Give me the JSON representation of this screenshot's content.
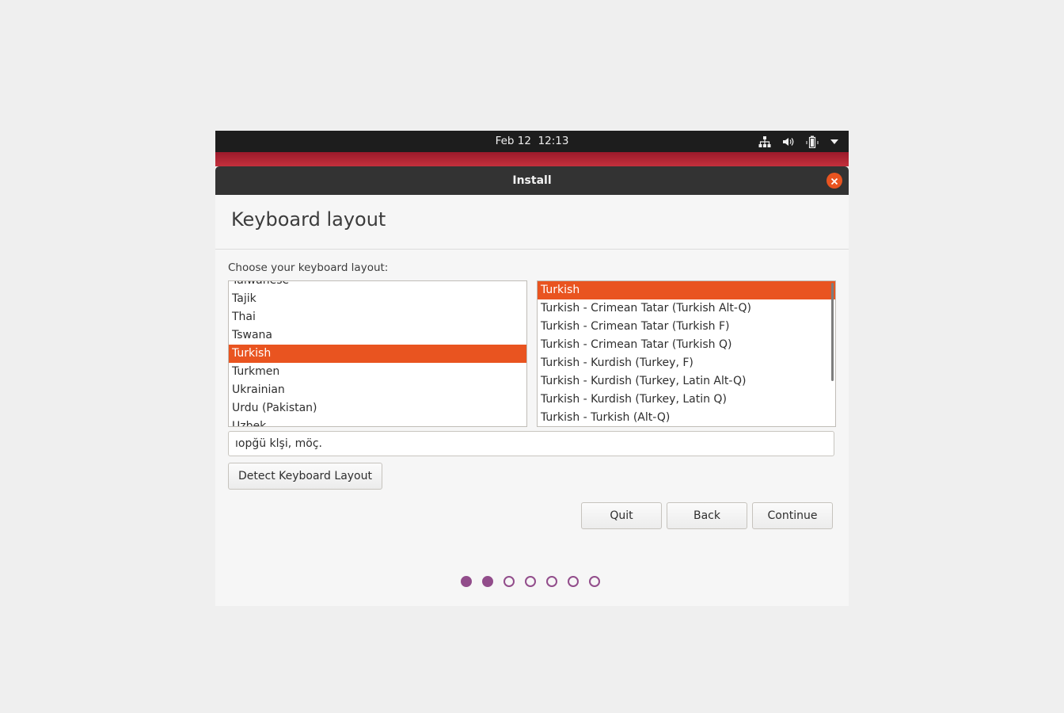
{
  "topbar": {
    "datetime": "Feb 12  12:13",
    "tray_icons": [
      "network-icon",
      "volume-icon",
      "battery-icon",
      "menu-arrow-icon"
    ]
  },
  "window": {
    "title": "Install"
  },
  "page": {
    "title": "Keyboard layout",
    "prompt": "Choose your keyboard layout:"
  },
  "layouts": {
    "items": [
      "Taiwanese",
      "Tajik",
      "Thai",
      "Tswana",
      "Turkish",
      "Turkmen",
      "Ukrainian",
      "Urdu (Pakistan)",
      "Uzbek"
    ],
    "selected": "Turkish"
  },
  "variants": {
    "items": [
      "Turkish",
      "Turkish - Crimean Tatar (Turkish Alt-Q)",
      "Turkish - Crimean Tatar (Turkish F)",
      "Turkish - Crimean Tatar (Turkish Q)",
      "Turkish - Kurdish (Turkey, F)",
      "Turkish - Kurdish (Turkey, Latin Alt-Q)",
      "Turkish - Kurdish (Turkey, Latin Q)",
      "Turkish - Turkish (Alt-Q)"
    ],
    "selected": "Turkish"
  },
  "test_input": {
    "value": "ıopğü klşi, möç."
  },
  "buttons": {
    "detect": "Detect Keyboard Layout",
    "quit": "Quit",
    "back": "Back",
    "continue": "Continue"
  },
  "progress": {
    "total_steps": 7,
    "completed_steps": 2
  },
  "colors": {
    "accent": "#e95420",
    "progress_dot": "#924d8b",
    "titlebar": "#333333",
    "topbar": "#1d1d1d"
  }
}
